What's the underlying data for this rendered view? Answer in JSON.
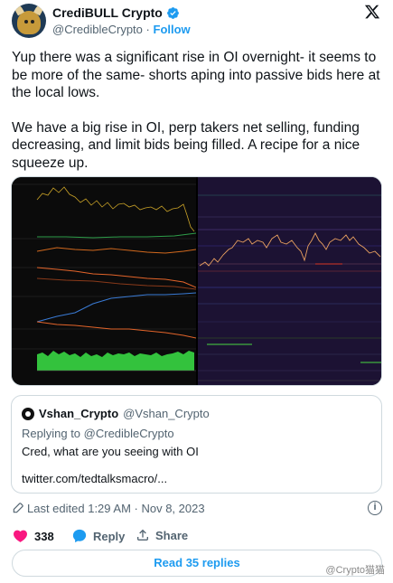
{
  "author": {
    "name": "CrediBULL Crypto",
    "handle": "@CredibleCrypto",
    "separator": "·",
    "follow_label": "Follow"
  },
  "tweet": {
    "paragraphs": [
      "Yup there was a significant rise in OI overnight- it seems to be more of the same- shorts aping into passive bids here at the local lows.",
      "We have a big rise in OI, perp takers net selling, funding decreasing, and limit bids being filled. A recipe for a nice squeeze up."
    ]
  },
  "quoted_tweet": {
    "name": "Vshan_Crypto",
    "handle": "@Vshan_Crypto",
    "replying_to": "Replying to @CredibleCrypto",
    "text": "Cred, what are you seeing with OI",
    "link": "twitter.com/tedtalksmacro/..."
  },
  "meta": {
    "edited": "Last edited 1:29 AM · Nov 8, 2023"
  },
  "actions": {
    "likes_count": "338",
    "reply_label": "Reply",
    "share_label": "Share"
  },
  "read_replies_label": "Read 35 replies",
  "watermark": "@Crypto猫猫",
  "colors": {
    "accent": "#1d9bf0",
    "text": "#0f1419",
    "secondary": "#536471",
    "like": "#f91880",
    "border": "#cfd9de"
  },
  "icons": [
    "verified-badge-icon",
    "x-logo-icon",
    "pencil-icon",
    "info-icon",
    "heart-icon",
    "reply-bubble-icon",
    "share-icon"
  ]
}
